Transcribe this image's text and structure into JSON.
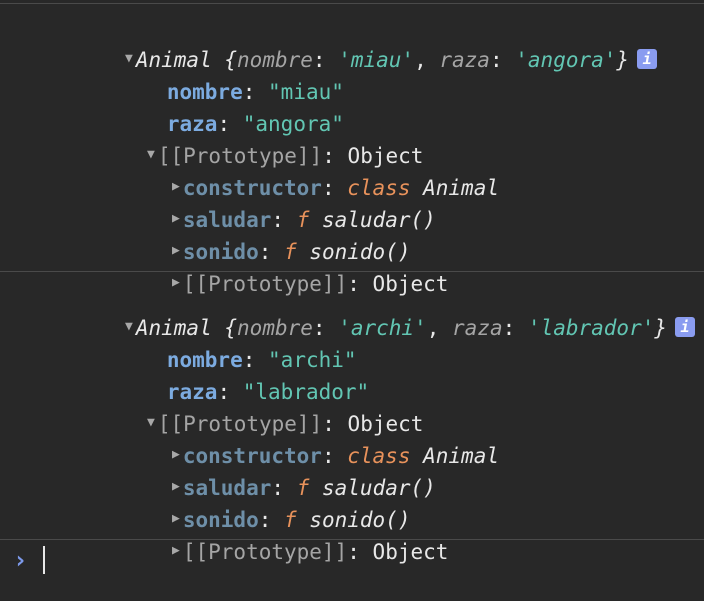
{
  "entries": [
    {
      "class_name": "Animal",
      "preview_open": "{",
      "preview_key1": "nombre",
      "preview_val1": "'miau'",
      "preview_key2": "raza",
      "preview_val2": "'angora'",
      "preview_close": "}",
      "info_glyph": "i",
      "props": [
        {
          "key": "nombre",
          "value": "\"miau\""
        },
        {
          "key": "raza",
          "value": "\"angora\""
        }
      ],
      "prototype_label": "[[Prototype]]",
      "prototype_value": "Object",
      "proto_items": {
        "constructor_key": "constructor",
        "constructor_kw": "class",
        "constructor_val": "Animal",
        "saludar_key": "saludar",
        "saludar_kw": "f",
        "saludar_val": "saludar()",
        "sonido_key": "sonido",
        "sonido_kw": "f",
        "sonido_val": "sonido()",
        "inner_proto_label": "[[Prototype]]",
        "inner_proto_value": "Object"
      }
    },
    {
      "class_name": "Animal",
      "preview_open": "{",
      "preview_key1": "nombre",
      "preview_val1": "'archi'",
      "preview_key2": "raza",
      "preview_val2": "'labrador'",
      "preview_close": "}",
      "info_glyph": "i",
      "props": [
        {
          "key": "nombre",
          "value": "\"archi\""
        },
        {
          "key": "raza",
          "value": "\"labrador\""
        }
      ],
      "prototype_label": "[[Prototype]]",
      "prototype_value": "Object",
      "proto_items": {
        "constructor_key": "constructor",
        "constructor_kw": "class",
        "constructor_val": "Animal",
        "saludar_key": "saludar",
        "saludar_kw": "f",
        "saludar_val": "saludar()",
        "sonido_key": "sonido",
        "sonido_kw": "f",
        "sonido_val": "sonido()",
        "inner_proto_label": "[[Prototype]]",
        "inner_proto_value": "Object"
      }
    }
  ],
  "punct": {
    "colon": ":",
    "comma": ","
  },
  "icons": {
    "expanded": "triangle-down-icon",
    "collapsed": "triangle-right-icon",
    "info": "info-icon",
    "prompt": "chevron-right-icon"
  },
  "prompt": {
    "glyph": "›",
    "value": ""
  },
  "colors": {
    "background": "#282828",
    "string": "#62c6b3",
    "key": "#7cabe0",
    "keyword": "#e8925b",
    "info_badge": "#8a9cf0",
    "prompt": "#7c99ea"
  }
}
